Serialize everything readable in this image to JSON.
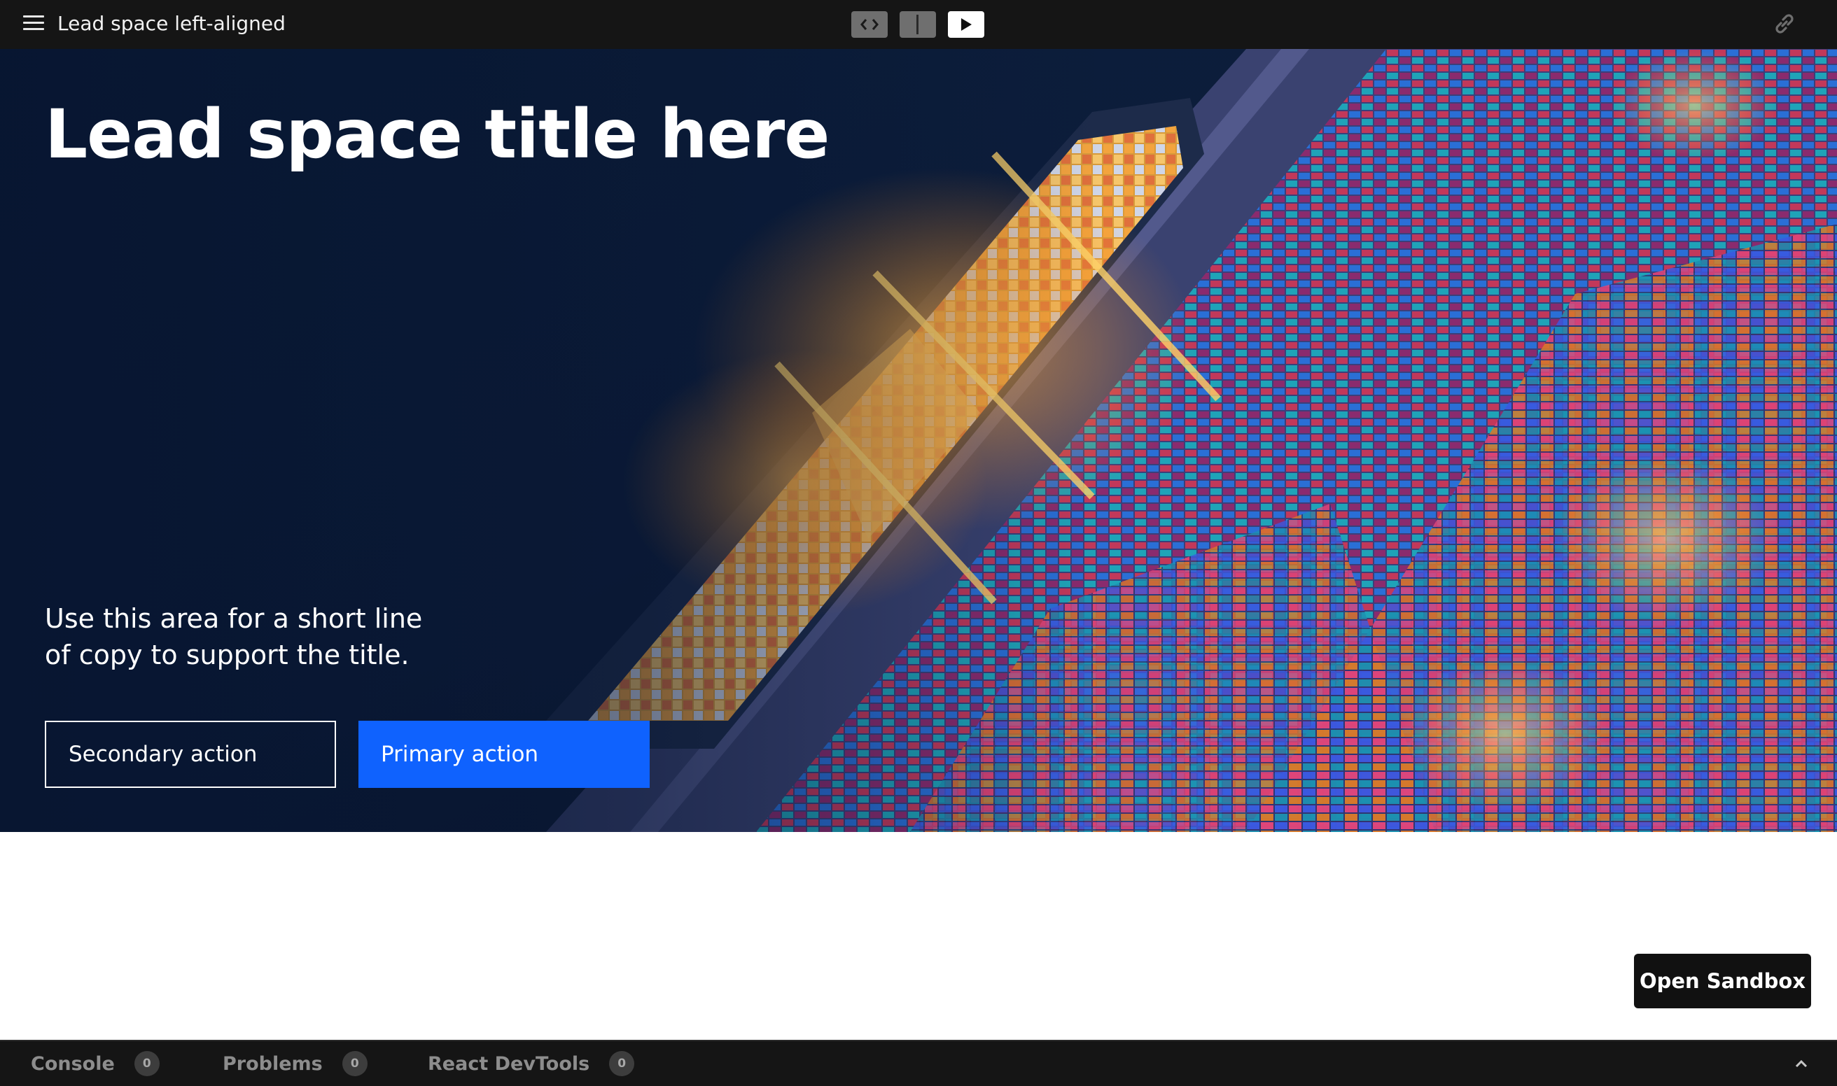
{
  "toolbar": {
    "title": "Lead space left-aligned",
    "menu_icon": "hamburger-menu-icon",
    "views": [
      {
        "name": "code",
        "icon": "code-icon"
      },
      {
        "name": "split",
        "icon": "split-view-icon"
      },
      {
        "name": "preview",
        "icon": "play-icon",
        "active": true
      }
    ],
    "link_icon": "link-icon"
  },
  "hero": {
    "title": "Lead space title here",
    "copy": "Use this area for a short line of copy to support the title.",
    "secondary_action": "Secondary action",
    "primary_action": "Primary action",
    "background_image": "aerial-container-port-photo",
    "primary_color": "#0f62fe"
  },
  "open_sandbox": {
    "label": "Open Sandbox"
  },
  "devtools": {
    "tabs": [
      {
        "label": "Console",
        "count": "0"
      },
      {
        "label": "Problems",
        "count": "0"
      },
      {
        "label": "React DevTools",
        "count": "0"
      }
    ],
    "expand_icon": "chevron-up-icon"
  }
}
